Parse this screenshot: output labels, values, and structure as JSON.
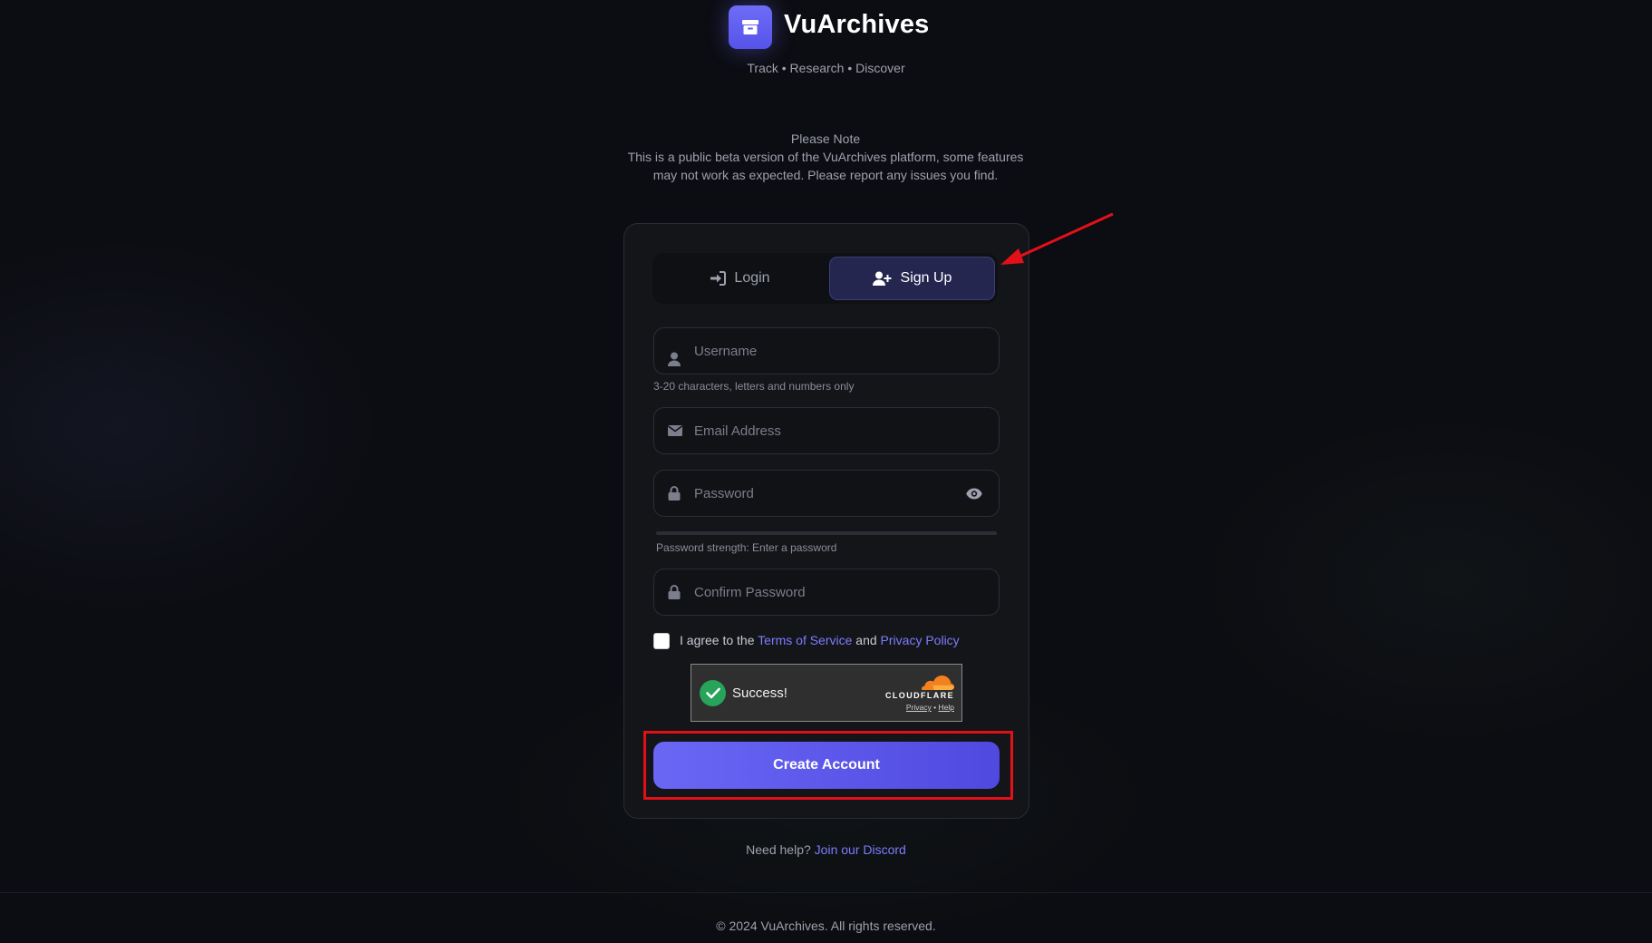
{
  "header": {
    "brand": "VuArchives",
    "tagline": "Track • Research • Discover",
    "logo_icon": "archive-icon"
  },
  "note": {
    "title": "Please Note",
    "body": "This is a public beta version of the VuArchives platform, some features may not work as expected. Please report any issues you find."
  },
  "tabs": {
    "login_label": "Login",
    "signup_label": "Sign Up",
    "active": "Sign Up"
  },
  "form": {
    "username_placeholder": "Username",
    "username_hint": "3-20 characters, letters and numbers only",
    "email_placeholder": "Email Address",
    "password_placeholder": "Password",
    "password_strength": "Password strength: Enter a password",
    "password_strength_level": 0,
    "confirm_placeholder": "Confirm Password",
    "agree_prefix": "I agree to the",
    "terms_link": "Terms of Service",
    "agree_and": "and",
    "privacy_link": "Privacy Policy",
    "submit_label": "Create Account"
  },
  "captcha": {
    "status": "Success!",
    "brand": "CLOUDFLARE",
    "privacy": "Privacy",
    "separator": "•",
    "help": "Help"
  },
  "help": {
    "prefix": "Need help?",
    "link": "Join our Discord"
  },
  "footer": {
    "copyright": "© 2024 VuArchives. All rights reserved."
  },
  "colors": {
    "accent": "#6a67f5",
    "background": "#0c0d12",
    "card": "#141519",
    "link": "#7c7cff",
    "annotation": "#e3101a",
    "captcha_success": "#27a35a",
    "cloudflare_orange": "#f48120"
  }
}
